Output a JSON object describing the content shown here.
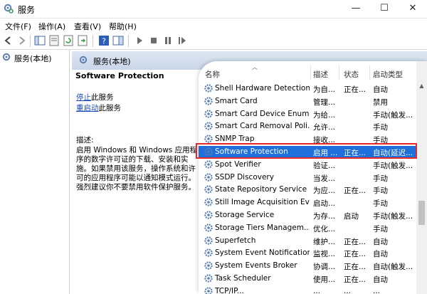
{
  "window": {
    "title": "服务",
    "minimize": "—",
    "maximize": "☐",
    "close": "✕"
  },
  "menu": [
    "文件(F)",
    "操作(A)",
    "查看(V)",
    "帮助(H)"
  ],
  "tree": {
    "root_label": "服务(本地)"
  },
  "panel": {
    "header": "服务(本地)"
  },
  "details": {
    "title": "Software Protection",
    "stop_link": "停止",
    "stop_suffix": "此服务",
    "restart_link": "重启动",
    "restart_suffix": "此服务",
    "desc_label": "描述:",
    "desc_lines": [
      "启用 Windows 和 Windows 应用程",
      "序的数字许可证的下载、安装和实",
      "施。如果禁用该服务，操作系统和许",
      "可的应用程序可能以通知模式运行。",
      "强烈建议你不要禁用软件保护服务。"
    ]
  },
  "columns": {
    "name": "名称",
    "desc": "描述",
    "status": "状态",
    "startup": "启动类型"
  },
  "services": [
    {
      "name": "Shell Hardware Detection",
      "desc": "为自...",
      "status": "正在...",
      "startup": "自动"
    },
    {
      "name": "Smart Card",
      "desc": "管理...",
      "status": "",
      "startup": "禁用"
    },
    {
      "name": "Smart Card Device Enum...",
      "desc": "为给...",
      "status": "",
      "startup": "手动(触发..."
    },
    {
      "name": "Smart Card Removal Poli...",
      "desc": "允许...",
      "status": "",
      "startup": "手动"
    },
    {
      "name": "SNMP Trap",
      "desc": "接收...",
      "status": "",
      "startup": "手动"
    },
    {
      "name": "Software Protection",
      "desc": "启用 ...",
      "status": "正在...",
      "startup": "自动(延迟..."
    },
    {
      "name": "Spot Verifier",
      "desc": "验证...",
      "status": "",
      "startup": "手动(触发..."
    },
    {
      "name": "SSDP Discovery",
      "desc": "当发...",
      "status": "",
      "startup": "手动"
    },
    {
      "name": "State Repository Service",
      "desc": "为应...",
      "status": "正在...",
      "startup": "手动"
    },
    {
      "name": "Still Image Acquisition Ev...",
      "desc": "启动...",
      "status": "",
      "startup": "手动"
    },
    {
      "name": "Storage Service",
      "desc": "为存...",
      "status": "启动",
      "startup": "手动(触发..."
    },
    {
      "name": "Storage Tiers Managem...",
      "desc": "优化...",
      "status": "",
      "startup": "手动"
    },
    {
      "name": "Superfetch",
      "desc": "维护...",
      "status": "正在...",
      "startup": "自动"
    },
    {
      "name": "System Event Notification...",
      "desc": "监视...",
      "status": "正在...",
      "startup": "自动"
    },
    {
      "name": "System Events Broker",
      "desc": "协调...",
      "status": "正在...",
      "startup": "自动(触发..."
    },
    {
      "name": "Task Scheduler",
      "desc": "使用...",
      "status": "正在...",
      "startup": "自动"
    },
    {
      "name": "TCP/IP...",
      "desc": "...",
      "status": "...",
      "startup": "..."
    }
  ],
  "selected_index": 5,
  "colors": {
    "accent": "#1e6fd9",
    "highlight_border": "#e8282d",
    "link": "#1a4bb5"
  }
}
